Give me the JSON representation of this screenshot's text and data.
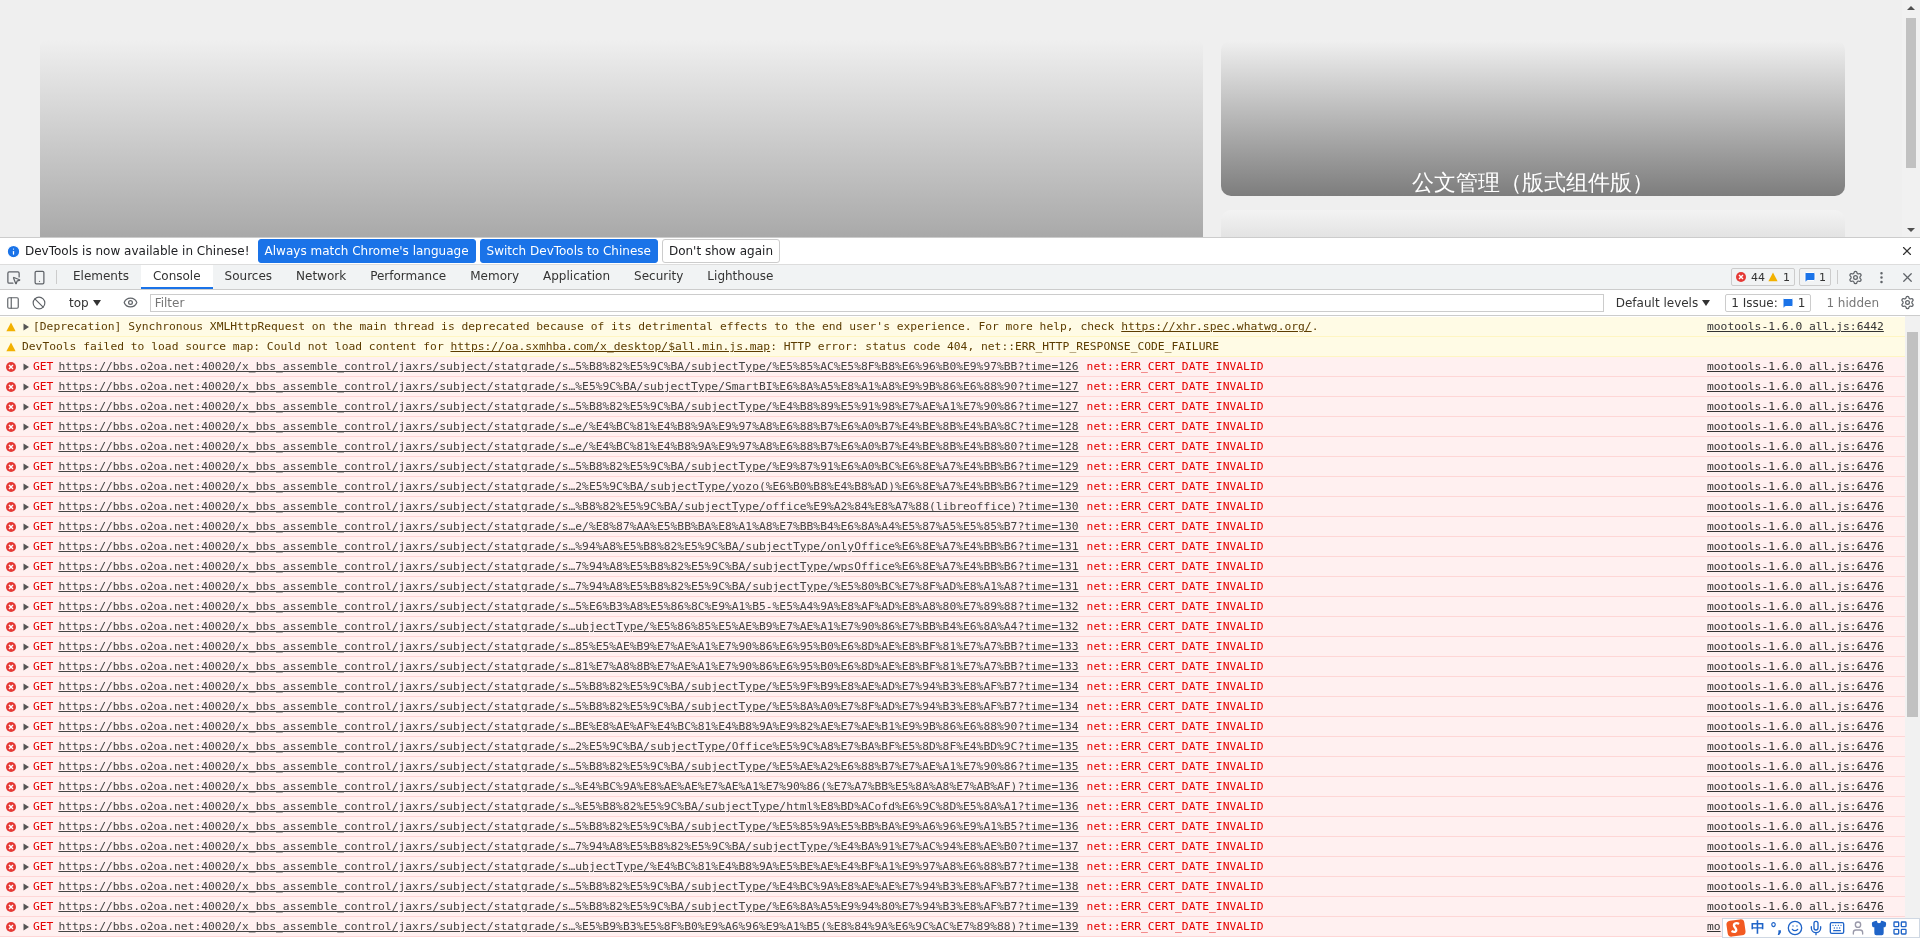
{
  "page": {
    "card_title": "公文管理（版式组件版）"
  },
  "infobar": {
    "message": "DevTools is now available in Chinese!",
    "buttons": [
      {
        "label": "Always match Chrome's language",
        "kind": "primary"
      },
      {
        "label": "Switch DevTools to Chinese",
        "kind": "primary"
      },
      {
        "label": "Don't show again",
        "kind": "plain"
      }
    ]
  },
  "tabs": [
    {
      "label": "Elements",
      "selected": false
    },
    {
      "label": "Console",
      "selected": true
    },
    {
      "label": "Sources",
      "selected": false
    },
    {
      "label": "Network",
      "selected": false
    },
    {
      "label": "Performance",
      "selected": false
    },
    {
      "label": "Memory",
      "selected": false
    },
    {
      "label": "Application",
      "selected": false
    },
    {
      "label": "Security",
      "selected": false
    },
    {
      "label": "Lighthouse",
      "selected": false
    }
  ],
  "counts": {
    "errors": "44",
    "warnings": "1",
    "messages": "1"
  },
  "toolbar": {
    "context": "top",
    "filter_placeholder": "Filter",
    "levels": "Default levels",
    "issues_label": "1 Issue:",
    "issues_count": "1",
    "hidden": "1 hidden"
  },
  "messages": [
    {
      "kind": "warning",
      "expandable": true,
      "before": "[Deprecation] Synchronous XMLHttpRequest on the main thread is deprecated because of its detrimental effects to the end user's experience. For more help, check ",
      "link": "https://xhr.spec.whatwg.org/",
      "after": ".",
      "source": "mootools-1.6.0 all.js:6442"
    },
    {
      "kind": "warning",
      "expandable": false,
      "before": "DevTools failed to load source map: Could not load content for ",
      "link": "https://oa.sxmhba.com/x_desktop/$all.min.js.map",
      "after": ": HTTP error: status code 404, net::ERR_HTTP_RESPONSE_CODE_FAILURE"
    },
    {
      "kind": "error",
      "expandable": true,
      "method": "GET",
      "url": "https://bbs.o2oa.net:40020/x_bbs_assemble_control/jaxrs/subject/statgrade/s…5%B8%82%E5%9C%BA/subjectType/%E5%85%AC%E5%8F%B8%E6%96%B0%E9%97%BB?time=126",
      "error": "net::ERR_CERT_DATE_INVALID",
      "source": "mootools-1.6.0 all.js:6476"
    },
    {
      "kind": "error",
      "expandable": true,
      "method": "GET",
      "url": "https://bbs.o2oa.net:40020/x_bbs_assemble_control/jaxrs/subject/statgrade/s…%E5%9C%BA/subjectType/SmartBI%E6%8A%A5%E8%A1%A8%E9%9B%86%E6%88%90?time=127",
      "error": "net::ERR_CERT_DATE_INVALID",
      "source": "mootools-1.6.0 all.js:6476"
    },
    {
      "kind": "error",
      "expandable": true,
      "method": "GET",
      "url": "https://bbs.o2oa.net:40020/x_bbs_assemble_control/jaxrs/subject/statgrade/s…5%B8%82%E5%9C%BA/subjectType/%E4%B8%89%E5%91%98%E7%AE%A1%E7%90%86?time=127",
      "error": "net::ERR_CERT_DATE_INVALID",
      "source": "mootools-1.6.0 all.js:6476"
    },
    {
      "kind": "error",
      "expandable": true,
      "method": "GET",
      "url": "https://bbs.o2oa.net:40020/x_bbs_assemble_control/jaxrs/subject/statgrade/s…e/%E4%BC%81%E4%B8%9A%E9%97%A8%E6%88%B7%E6%A0%B7%E4%BE%8B%E4%BA%8C?time=128",
      "error": "net::ERR_CERT_DATE_INVALID",
      "source": "mootools-1.6.0 all.js:6476"
    },
    {
      "kind": "error",
      "expandable": true,
      "method": "GET",
      "url": "https://bbs.o2oa.net:40020/x_bbs_assemble_control/jaxrs/subject/statgrade/s…e/%E4%BC%81%E4%B8%9A%E9%97%A8%E6%88%B7%E6%A0%B7%E4%BE%8B%E4%B8%80?time=128",
      "error": "net::ERR_CERT_DATE_INVALID",
      "source": "mootools-1.6.0 all.js:6476"
    },
    {
      "kind": "error",
      "expandable": true,
      "method": "GET",
      "url": "https://bbs.o2oa.net:40020/x_bbs_assemble_control/jaxrs/subject/statgrade/s…5%B8%82%E5%9C%BA/subjectType/%E9%87%91%E6%A0%BC%E6%8E%A7%E4%BB%B6?time=129",
      "error": "net::ERR_CERT_DATE_INVALID",
      "source": "mootools-1.6.0 all.js:6476"
    },
    {
      "kind": "error",
      "expandable": true,
      "method": "GET",
      "url": "https://bbs.o2oa.net:40020/x_bbs_assemble_control/jaxrs/subject/statgrade/s…2%E5%9C%BA/subjectType/yozo(%E6%B0%B8%E4%B8%AD)%E6%8E%A7%E4%BB%B6?time=129",
      "error": "net::ERR_CERT_DATE_INVALID",
      "source": "mootools-1.6.0 all.js:6476"
    },
    {
      "kind": "error",
      "expandable": true,
      "method": "GET",
      "url": "https://bbs.o2oa.net:40020/x_bbs_assemble_control/jaxrs/subject/statgrade/s…%B8%82%E5%9C%BA/subjectType/office%E9%A2%84%E8%A7%88(libreoffice)?time=130",
      "error": "net::ERR_CERT_DATE_INVALID",
      "source": "mootools-1.6.0 all.js:6476"
    },
    {
      "kind": "error",
      "expandable": true,
      "method": "GET",
      "url": "https://bbs.o2oa.net:40020/x_bbs_assemble_control/jaxrs/subject/statgrade/s…e/%E8%87%AA%E5%BB%BA%E8%A1%A8%E7%BB%B4%E6%8A%A4%E5%87%A5%E5%85%B7?time=130",
      "error": "net::ERR_CERT_DATE_INVALID",
      "source": "mootools-1.6.0 all.js:6476"
    },
    {
      "kind": "error",
      "expandable": true,
      "method": "GET",
      "url": "https://bbs.o2oa.net:40020/x_bbs_assemble_control/jaxrs/subject/statgrade/s…%94%A8%E5%B8%82%E5%9C%BA/subjectType/onlyOffice%E6%8E%A7%E4%BB%B6?time=131",
      "error": "net::ERR_CERT_DATE_INVALID",
      "source": "mootools-1.6.0 all.js:6476"
    },
    {
      "kind": "error",
      "expandable": true,
      "method": "GET",
      "url": "https://bbs.o2oa.net:40020/x_bbs_assemble_control/jaxrs/subject/statgrade/s…7%94%A8%E5%B8%82%E5%9C%BA/subjectType/wpsOffice%E6%8E%A7%E4%BB%B6?time=131",
      "error": "net::ERR_CERT_DATE_INVALID",
      "source": "mootools-1.6.0 all.js:6476"
    },
    {
      "kind": "error",
      "expandable": true,
      "method": "GET",
      "url": "https://bbs.o2oa.net:40020/x_bbs_assemble_control/jaxrs/subject/statgrade/s…7%94%A8%E5%B8%82%E5%9C%BA/subjectType/%E5%80%BC%E7%8F%AD%E8%A1%A8?time=131",
      "error": "net::ERR_CERT_DATE_INVALID",
      "source": "mootools-1.6.0 all.js:6476"
    },
    {
      "kind": "error",
      "expandable": true,
      "method": "GET",
      "url": "https://bbs.o2oa.net:40020/x_bbs_assemble_control/jaxrs/subject/statgrade/s…5%E6%B3%A8%E5%86%8C%E9%A1%B5-%E5%A4%9A%E8%AF%AD%E8%A8%80%E7%89%88?time=132",
      "error": "net::ERR_CERT_DATE_INVALID",
      "source": "mootools-1.6.0 all.js:6476"
    },
    {
      "kind": "error",
      "expandable": true,
      "method": "GET",
      "url": "https://bbs.o2oa.net:40020/x_bbs_assemble_control/jaxrs/subject/statgrade/s…ubjectType/%E5%86%85%E5%AE%B9%E7%AE%A1%E7%90%86%E7%BB%B4%E6%8A%A4?time=132",
      "error": "net::ERR_CERT_DATE_INVALID",
      "source": "mootools-1.6.0 all.js:6476"
    },
    {
      "kind": "error",
      "expandable": true,
      "method": "GET",
      "url": "https://bbs.o2oa.net:40020/x_bbs_assemble_control/jaxrs/subject/statgrade/s…85%E5%AE%B9%E7%AE%A1%E7%90%86%E6%95%B0%E6%8D%AE%E8%BF%81%E7%A7%BB?time=133",
      "error": "net::ERR_CERT_DATE_INVALID",
      "source": "mootools-1.6.0 all.js:6476"
    },
    {
      "kind": "error",
      "expandable": true,
      "method": "GET",
      "url": "https://bbs.o2oa.net:40020/x_bbs_assemble_control/jaxrs/subject/statgrade/s…81%E7%A8%8B%E7%AE%A1%E7%90%86%E6%95%B0%E6%8D%AE%E8%BF%81%E7%A7%BB?time=133",
      "error": "net::ERR_CERT_DATE_INVALID",
      "source": "mootools-1.6.0 all.js:6476"
    },
    {
      "kind": "error",
      "expandable": true,
      "method": "GET",
      "url": "https://bbs.o2oa.net:40020/x_bbs_assemble_control/jaxrs/subject/statgrade/s…5%B8%82%E5%9C%BA/subjectType/%E5%9F%B9%E8%AE%AD%E7%94%B3%E8%AF%B7?time=134",
      "error": "net::ERR_CERT_DATE_INVALID",
      "source": "mootools-1.6.0 all.js:6476"
    },
    {
      "kind": "error",
      "expandable": true,
      "method": "GET",
      "url": "https://bbs.o2oa.net:40020/x_bbs_assemble_control/jaxrs/subject/statgrade/s…5%B8%82%E5%9C%BA/subjectType/%E5%8A%A0%E7%8F%AD%E7%94%B3%E8%AF%B7?time=134",
      "error": "net::ERR_CERT_DATE_INVALID",
      "source": "mootools-1.6.0 all.js:6476"
    },
    {
      "kind": "error",
      "expandable": true,
      "method": "GET",
      "url": "https://bbs.o2oa.net:40020/x_bbs_assemble_control/jaxrs/subject/statgrade/s…BE%E8%AE%AF%E4%BC%81%E4%B8%9A%E9%82%AE%E7%AE%B1%E9%9B%86%E6%88%90?time=134",
      "error": "net::ERR_CERT_DATE_INVALID",
      "source": "mootools-1.6.0 all.js:6476"
    },
    {
      "kind": "error",
      "expandable": true,
      "method": "GET",
      "url": "https://bbs.o2oa.net:40020/x_bbs_assemble_control/jaxrs/subject/statgrade/s…2%E5%9C%BA/subjectType/Office%E5%9C%A8%E7%BA%BF%E5%8D%8F%E4%BD%9C?time=135",
      "error": "net::ERR_CERT_DATE_INVALID",
      "source": "mootools-1.6.0 all.js:6476"
    },
    {
      "kind": "error",
      "expandable": true,
      "method": "GET",
      "url": "https://bbs.o2oa.net:40020/x_bbs_assemble_control/jaxrs/subject/statgrade/s…5%B8%82%E5%9C%BA/subjectType/%E5%AE%A2%E6%88%B7%E7%AE%A1%E7%90%86?time=135",
      "error": "net::ERR_CERT_DATE_INVALID",
      "source": "mootools-1.6.0 all.js:6476"
    },
    {
      "kind": "error",
      "expandable": true,
      "method": "GET",
      "url": "https://bbs.o2oa.net:40020/x_bbs_assemble_control/jaxrs/subject/statgrade/s…%E4%BC%9A%E8%AE%AE%E7%AE%A1%E7%90%86(%E7%A7%BB%E5%8A%A8%E7%AB%AF)?time=136",
      "error": "net::ERR_CERT_DATE_INVALID",
      "source": "mootools-1.6.0 all.js:6476"
    },
    {
      "kind": "error",
      "expandable": true,
      "method": "GET",
      "url": "https://bbs.o2oa.net:40020/x_bbs_assemble_control/jaxrs/subject/statgrade/s…%E5%B8%82%E5%9C%BA/subjectType/html%E8%BD%ACofd%E6%9C%8D%E5%8A%A1?time=136",
      "error": "net::ERR_CERT_DATE_INVALID",
      "source": "mootools-1.6.0 all.js:6476"
    },
    {
      "kind": "error",
      "expandable": true,
      "method": "GET",
      "url": "https://bbs.o2oa.net:40020/x_bbs_assemble_control/jaxrs/subject/statgrade/s…5%B8%82%E5%9C%BA/subjectType/%E5%85%9A%E5%BB%BA%E9%A6%96%E9%A1%B5?time=136",
      "error": "net::ERR_CERT_DATE_INVALID",
      "source": "mootools-1.6.0 all.js:6476"
    },
    {
      "kind": "error",
      "expandable": true,
      "method": "GET",
      "url": "https://bbs.o2oa.net:40020/x_bbs_assemble_control/jaxrs/subject/statgrade/s…7%94%A8%E5%B8%82%E5%9C%BA/subjectType/%E4%BA%91%E7%AC%94%E8%AE%B0?time=137",
      "error": "net::ERR_CERT_DATE_INVALID",
      "source": "mootools-1.6.0 all.js:6476"
    },
    {
      "kind": "error",
      "expandable": true,
      "method": "GET",
      "url": "https://bbs.o2oa.net:40020/x_bbs_assemble_control/jaxrs/subject/statgrade/s…ubjectType/%E4%BC%81%E4%B8%9A%E5%BE%AE%E4%BF%A1%E9%97%A8%E6%88%B7?time=138",
      "error": "net::ERR_CERT_DATE_INVALID",
      "source": "mootools-1.6.0 all.js:6476"
    },
    {
      "kind": "error",
      "expandable": true,
      "method": "GET",
      "url": "https://bbs.o2oa.net:40020/x_bbs_assemble_control/jaxrs/subject/statgrade/s…5%B8%82%E5%9C%BA/subjectType/%E4%BC%9A%E8%AE%AE%E7%94%B3%E8%AF%B7?time=138",
      "error": "net::ERR_CERT_DATE_INVALID",
      "source": "mootools-1.6.0 all.js:6476"
    },
    {
      "kind": "error",
      "expandable": true,
      "method": "GET",
      "url": "https://bbs.o2oa.net:40020/x_bbs_assemble_control/jaxrs/subject/statgrade/s…5%B8%82%E5%9C%BA/subjectType/%E6%8A%A5%E9%94%80%E7%94%B3%E8%AF%B7?time=139",
      "error": "net::ERR_CERT_DATE_INVALID",
      "source": "mootools-1.6.0 all.js:6476"
    },
    {
      "kind": "error",
      "expandable": true,
      "method": "GET",
      "url": "https://bbs.o2oa.net:40020/x_bbs_assemble_control/jaxrs/subject/statgrade/s…%E5%B9%B3%E5%8F%B0%E9%A6%96%E9%A1%B5(%E8%84%9A%E6%9C%AC%E7%89%88)?time=139",
      "error": "net::ERR_CERT_DATE_INVALID",
      "source": "mo"
    }
  ],
  "ime": {
    "mode": "中",
    "punctuation": "°,"
  }
}
